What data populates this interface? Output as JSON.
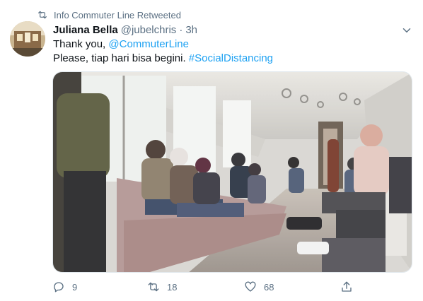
{
  "retweet_context": {
    "text": "Info Commuter Line Retweeted"
  },
  "tweet": {
    "author_name": "Juliana Bella",
    "handle": "@jubelchris",
    "separator": "·",
    "time": "3h",
    "line1_prefix": "Thank you, ",
    "mention": "@CommuterLine",
    "line2_prefix": "Please, tiap hari bisa begini. ",
    "hashtag": "#SocialDistancing"
  },
  "actions": {
    "reply_count": "9",
    "retweet_count": "18",
    "like_count": "68"
  },
  "colors": {
    "link": "#1da1f2",
    "muted": "#5b7083",
    "text": "#0f1419"
  },
  "icons": {
    "retweet_context": "retweet-icon",
    "menu": "chevron-down-icon",
    "reply": "reply-icon",
    "retweet": "retweet-icon",
    "like": "heart-icon",
    "share": "share-icon"
  },
  "media": {
    "description_icon": "photo"
  }
}
